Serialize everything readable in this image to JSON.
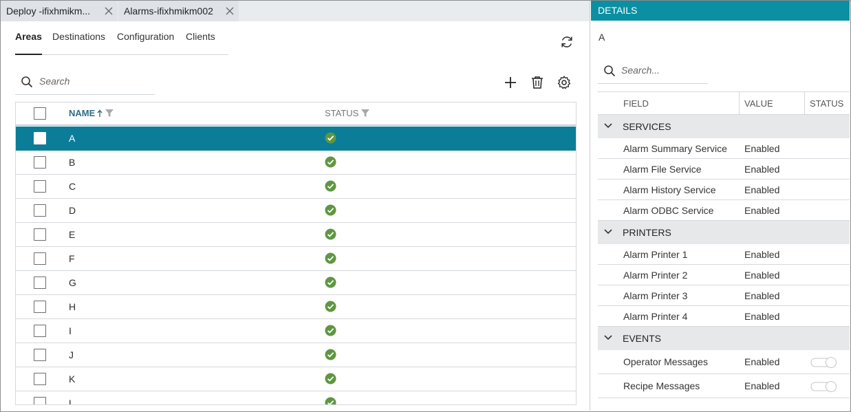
{
  "doc_tabs": [
    {
      "label": "Deploy -ifixhmikm..."
    },
    {
      "label": "Alarms-ifixhmikm002"
    }
  ],
  "subtabs": [
    {
      "label": "Areas",
      "active": true
    },
    {
      "label": "Destinations",
      "active": false
    },
    {
      "label": "Configuration",
      "active": false
    },
    {
      "label": "Clients",
      "active": false
    }
  ],
  "search": {
    "placeholder": "Search"
  },
  "toolbar": {
    "add_icon": "plus-icon",
    "delete_icon": "trash-icon",
    "settings_icon": "gear-icon",
    "refresh_icon": "refresh-icon"
  },
  "grid": {
    "columns": {
      "name": "NAME",
      "status": "STATUS"
    },
    "sort": "ascending",
    "rows": [
      {
        "name": "A",
        "selected": true,
        "status": "ok"
      },
      {
        "name": "B",
        "selected": false,
        "status": "ok"
      },
      {
        "name": "C",
        "selected": false,
        "status": "ok"
      },
      {
        "name": "D",
        "selected": false,
        "status": "ok"
      },
      {
        "name": "E",
        "selected": false,
        "status": "ok"
      },
      {
        "name": "F",
        "selected": false,
        "status": "ok"
      },
      {
        "name": "G",
        "selected": false,
        "status": "ok"
      },
      {
        "name": "H",
        "selected": false,
        "status": "ok"
      },
      {
        "name": "I",
        "selected": false,
        "status": "ok"
      },
      {
        "name": "J",
        "selected": false,
        "status": "ok"
      },
      {
        "name": "K",
        "selected": false,
        "status": "ok"
      },
      {
        "name": "L",
        "selected": false,
        "status": "ok"
      }
    ]
  },
  "details": {
    "title": "DETAILS",
    "selected_name": "A",
    "search_placeholder": "Search...",
    "columns": {
      "field": "FIELD",
      "value": "VALUE",
      "status": "STATUS"
    },
    "groups": [
      {
        "label": "SERVICES",
        "rows": [
          {
            "field": "Alarm Summary Service",
            "value": "Enabled"
          },
          {
            "field": "Alarm File Service",
            "value": "Enabled"
          },
          {
            "field": "Alarm History Service",
            "value": "Enabled"
          },
          {
            "field": "Alarm ODBC Service",
            "value": "Enabled"
          }
        ]
      },
      {
        "label": "PRINTERS",
        "rows": [
          {
            "field": "Alarm Printer 1",
            "value": "Enabled"
          },
          {
            "field": "Alarm Printer 2",
            "value": "Enabled"
          },
          {
            "field": "Alarm Printer 3",
            "value": "Enabled"
          },
          {
            "field": "Alarm Printer 4",
            "value": "Enabled"
          }
        ]
      },
      {
        "label": "EVENTS",
        "rows": [
          {
            "field": "Operator Messages",
            "value": "Enabled",
            "toggle": true
          },
          {
            "field": "Recipe Messages",
            "value": "Enabled",
            "toggle": true
          }
        ]
      }
    ]
  },
  "colors": {
    "accent": "#0a8fa3",
    "selected_row": "#0b7d99",
    "status_ok": "#5f9642",
    "header_text": "#2d6c86"
  }
}
